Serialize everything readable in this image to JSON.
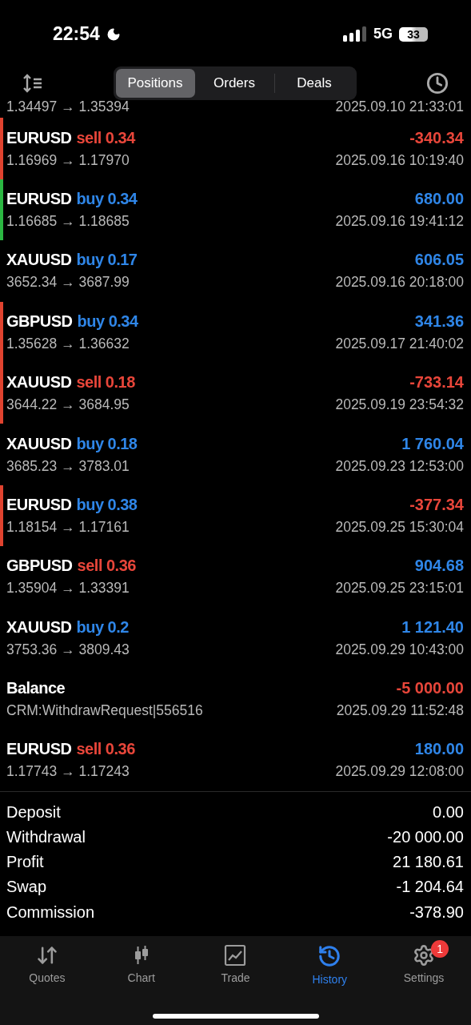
{
  "status_bar": {
    "time": "22:54",
    "network": "5G",
    "battery": "33"
  },
  "segments": [
    {
      "label": "Positions",
      "selected": true
    },
    {
      "label": "Orders",
      "selected": false
    },
    {
      "label": "Deals",
      "selected": false
    }
  ],
  "deals": [
    {
      "prices": "1.34497 → 1.35394",
      "time": "2025.09.10 21:33:01"
    },
    {
      "symbol": "EURUSD",
      "sell": true,
      "trade": "sell 0.34",
      "profit": "-340.34",
      "loss": true,
      "prices": "1.16969 → 1.17970",
      "time": "2025.09.16 10:19:40",
      "color": "#e0432f"
    },
    {
      "symbol": "EURUSD",
      "sell": false,
      "trade": "buy 0.34",
      "profit": "680.00",
      "loss": false,
      "prices": "1.16685 → 1.18685",
      "time": "2025.09.16 19:41:12",
      "color": "#2bb742"
    },
    {
      "symbol": "XAUUSD",
      "sell": false,
      "trade": "buy 0.17",
      "profit": "606.05",
      "loss": false,
      "prices": "3652.34 → 3687.99",
      "time": "2025.09.16 20:18:00"
    },
    {
      "symbol": "GBPUSD",
      "sell": false,
      "trade": "buy 0.34",
      "profit": "341.36",
      "loss": false,
      "prices": "1.35628 → 1.36632",
      "time": "2025.09.17 21:40:02",
      "color": "#e0432f"
    },
    {
      "symbol": "XAUUSD",
      "sell": true,
      "trade": "sell 0.18",
      "profit": "-733.14",
      "loss": true,
      "prices": "3644.22 → 3684.95",
      "time": "2025.09.19 23:54:32",
      "color": "#e0432f"
    },
    {
      "symbol": "XAUUSD",
      "sell": false,
      "trade": "buy 0.18",
      "profit": "1 760.04",
      "loss": false,
      "prices": "3685.23 → 3783.01",
      "time": "2025.09.23 12:53:00"
    },
    {
      "symbol": "EURUSD",
      "sell": false,
      "trade": "buy 0.38",
      "profit": "-377.34",
      "loss": true,
      "prices": "1.18154 → 1.17161",
      "time": "2025.09.25 15:30:04",
      "color": "#e0432f"
    },
    {
      "symbol": "GBPUSD",
      "sell": true,
      "trade": "sell 0.36",
      "profit": "904.68",
      "loss": false,
      "prices": "1.35904 → 1.33391",
      "time": "2025.09.25 23:15:01"
    },
    {
      "symbol": "XAUUSD",
      "sell": false,
      "trade": "buy 0.2",
      "profit": "1 121.40",
      "loss": false,
      "prices": "3753.36 → 3809.43",
      "time": "2025.09.29 10:43:00"
    },
    {
      "symbol": "Balance",
      "profit": "-5 000.00",
      "loss": true,
      "prices": "CRM:WithdrawRequest|556516",
      "time": "2025.09.29 11:52:48"
    },
    {
      "symbol": "EURUSD",
      "sell": true,
      "trade": "sell 0.36",
      "profit": "180.00",
      "loss": false,
      "prices": "1.17743 → 1.17243",
      "time": "2025.09.29 12:08:00"
    }
  ],
  "summary": [
    {
      "label": "Deposit",
      "value": "0.00"
    },
    {
      "label": "Withdrawal",
      "value": "-20 000.00"
    },
    {
      "label": "Profit",
      "value": "21 180.61"
    },
    {
      "label": "Swap",
      "value": "-1 204.64"
    },
    {
      "label": "Commission",
      "value": "-378.90"
    }
  ],
  "tab_bar": [
    {
      "kind": "quotes",
      "label": "Quotes",
      "selected": false
    },
    {
      "kind": "chart",
      "label": "Chart",
      "selected": false
    },
    {
      "kind": "trade",
      "label": "Trade",
      "selected": false
    },
    {
      "kind": "history",
      "label": "History",
      "selected": true
    },
    {
      "kind": "settings",
      "label": "Settings",
      "selected": false,
      "badge": "1"
    }
  ]
}
